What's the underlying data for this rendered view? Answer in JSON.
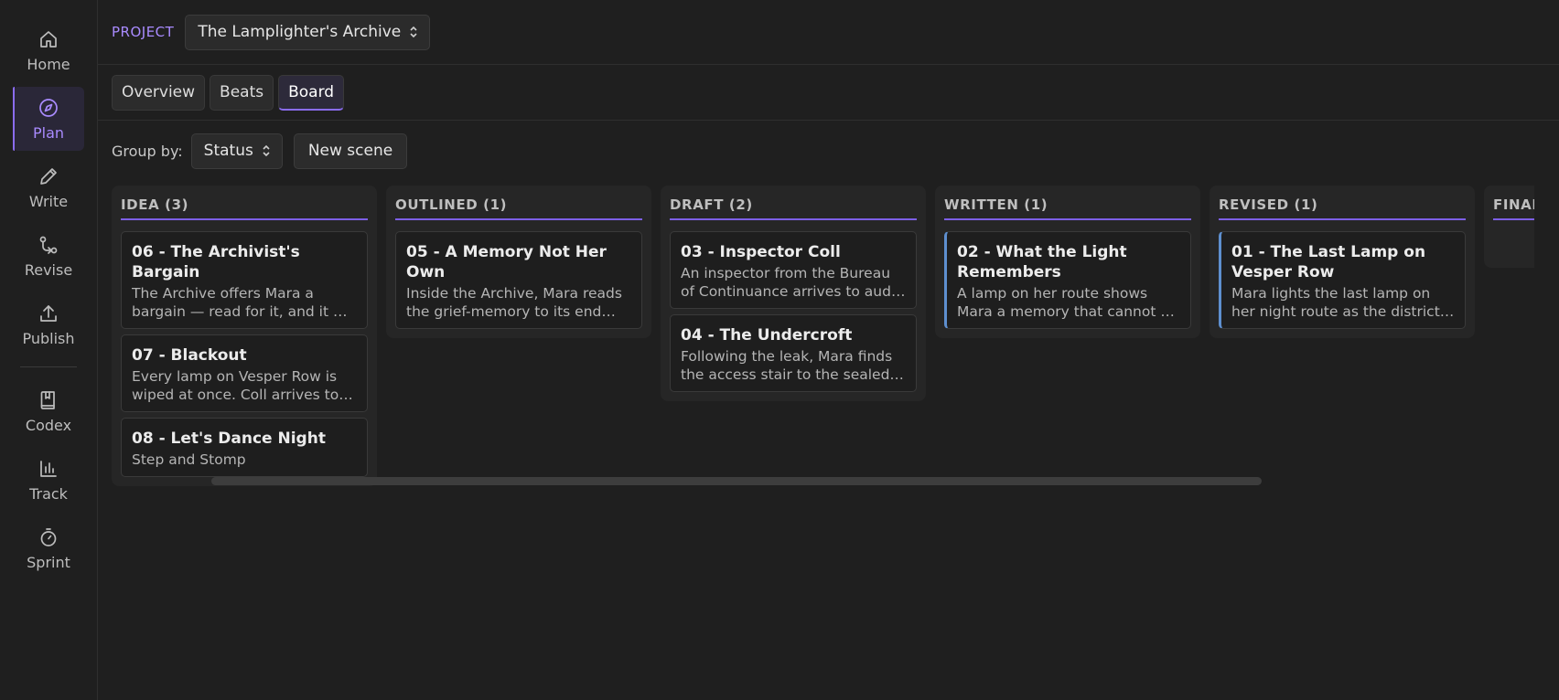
{
  "sidebar": {
    "items": [
      {
        "id": "home",
        "label": "Home",
        "icon": "home-icon"
      },
      {
        "id": "plan",
        "label": "Plan",
        "icon": "compass-icon",
        "active": true
      },
      {
        "id": "write",
        "label": "Write",
        "icon": "pencil-icon"
      },
      {
        "id": "revise",
        "label": "Revise",
        "icon": "git-branch-icon"
      },
      {
        "id": "publish",
        "label": "Publish",
        "icon": "upload-icon"
      },
      {
        "id": "codex",
        "label": "Codex",
        "icon": "book-icon"
      },
      {
        "id": "track",
        "label": "Track",
        "icon": "bar-chart-icon"
      },
      {
        "id": "sprint",
        "label": "Sprint",
        "icon": "stopwatch-icon"
      }
    ]
  },
  "header": {
    "project_label": "PROJECT",
    "project_name": "The Lamplighter's Archive"
  },
  "tabs": {
    "overview": "Overview",
    "beats": "Beats",
    "board": "Board",
    "active": "board"
  },
  "toolbar": {
    "group_by_label": "Group by:",
    "group_by_value": "Status",
    "new_scene_label": "New scene"
  },
  "board": {
    "columns": [
      {
        "title": "IDEA (3)",
        "cards": [
          {
            "title": "06 - The Archivist's Bargain",
            "summary": "The Archive offers Mara a bargain — read for it, and it will give her…"
          },
          {
            "title": "07 - Blackout",
            "summary": "Every lamp on Vesper Row is wiped at once. Coll arrives to a row that…"
          },
          {
            "title": "08 - Let's Dance Night",
            "summary": "Step and Stomp"
          }
        ]
      },
      {
        "title": "OUTLINED (1)",
        "cards": [
          {
            "title": "05 - A Memory Not Her Own",
            "summary": "Inside the Archive, Mara reads the grief-memory to its end and lear…"
          }
        ]
      },
      {
        "title": "DRAFT (2)",
        "cards": [
          {
            "title": "03 - Inspector Coll",
            "summary": "An inspector from the Bureau of Continuance arrives to audit the…"
          },
          {
            "title": "04 - The Undercroft",
            "summary": "Following the leak, Mara finds the access stair to the sealed…"
          }
        ]
      },
      {
        "title": "WRITTEN (1)",
        "cards": [
          {
            "title": "02 - What the Light Remembers",
            "summary": "A lamp on her route shows Mara a memory that cannot be hers — a…"
          }
        ]
      },
      {
        "title": "REVISED (1)",
        "cards": [
          {
            "title": "01 - The Last Lamp on Vesper Row",
            "summary": "Mara lights the last lamp on her night route as the district sleeps,…"
          }
        ]
      },
      {
        "title": "FINAL",
        "cards": []
      }
    ]
  }
}
